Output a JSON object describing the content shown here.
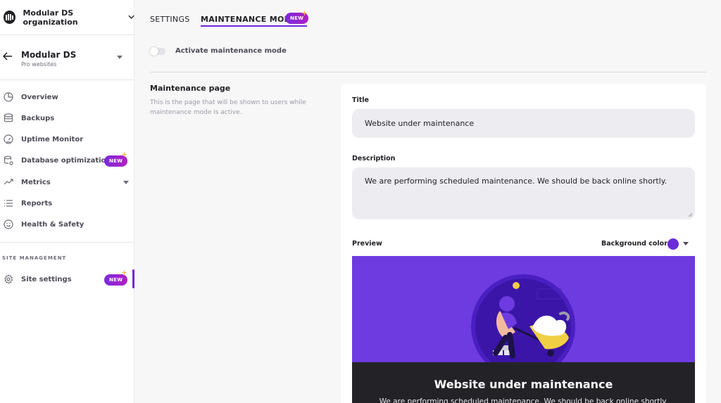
{
  "sidebar": {
    "org_name": "Modular DS organization",
    "site_name": "Modular DS",
    "site_subtitle": "Pro websites",
    "nav": [
      {
        "label": "Overview",
        "icon": "pie-chart-icon"
      },
      {
        "label": "Backups",
        "icon": "database-icon"
      },
      {
        "label": "Uptime Monitor",
        "icon": "gauge-icon"
      },
      {
        "label": "Database optimization",
        "icon": "database-settings-icon",
        "badge": "NEW"
      },
      {
        "label": "Metrics",
        "icon": "trending-up-icon"
      },
      {
        "label": "Reports",
        "icon": "list-icon"
      },
      {
        "label": "Health & Safety",
        "icon": "smile-icon"
      }
    ],
    "section_title": "SITE MANAGEMENT",
    "settings": {
      "label": "Site settings",
      "icon": "gear-icon",
      "badge": "NEW"
    }
  },
  "tabs": {
    "settings": "SETTINGS",
    "maintenance": "MAINTENANCE MODE",
    "badge": "NEW"
  },
  "toggle": {
    "label": "Activate maintenance mode",
    "on": false
  },
  "maintenance_page": {
    "title": "Maintenance page",
    "description": "This is the page that will be shown to users while maintenance mode is active."
  },
  "form": {
    "title_label": "Title",
    "title_value": "Website under maintenance",
    "description_label": "Description",
    "description_value": "We are performing scheduled maintenance. We should be back online shortly.",
    "preview_label": "Preview",
    "bg_color_label": "Background color",
    "bg_color": "#6b2bd9"
  },
  "preview": {
    "title": "Website under maintenance",
    "description": "We are performing scheduled maintenance. We should be back online shortly."
  },
  "colors": {
    "accent": "#6b2bd9",
    "preview_bg": "#6d3be0",
    "preview_footer": "#232327"
  }
}
